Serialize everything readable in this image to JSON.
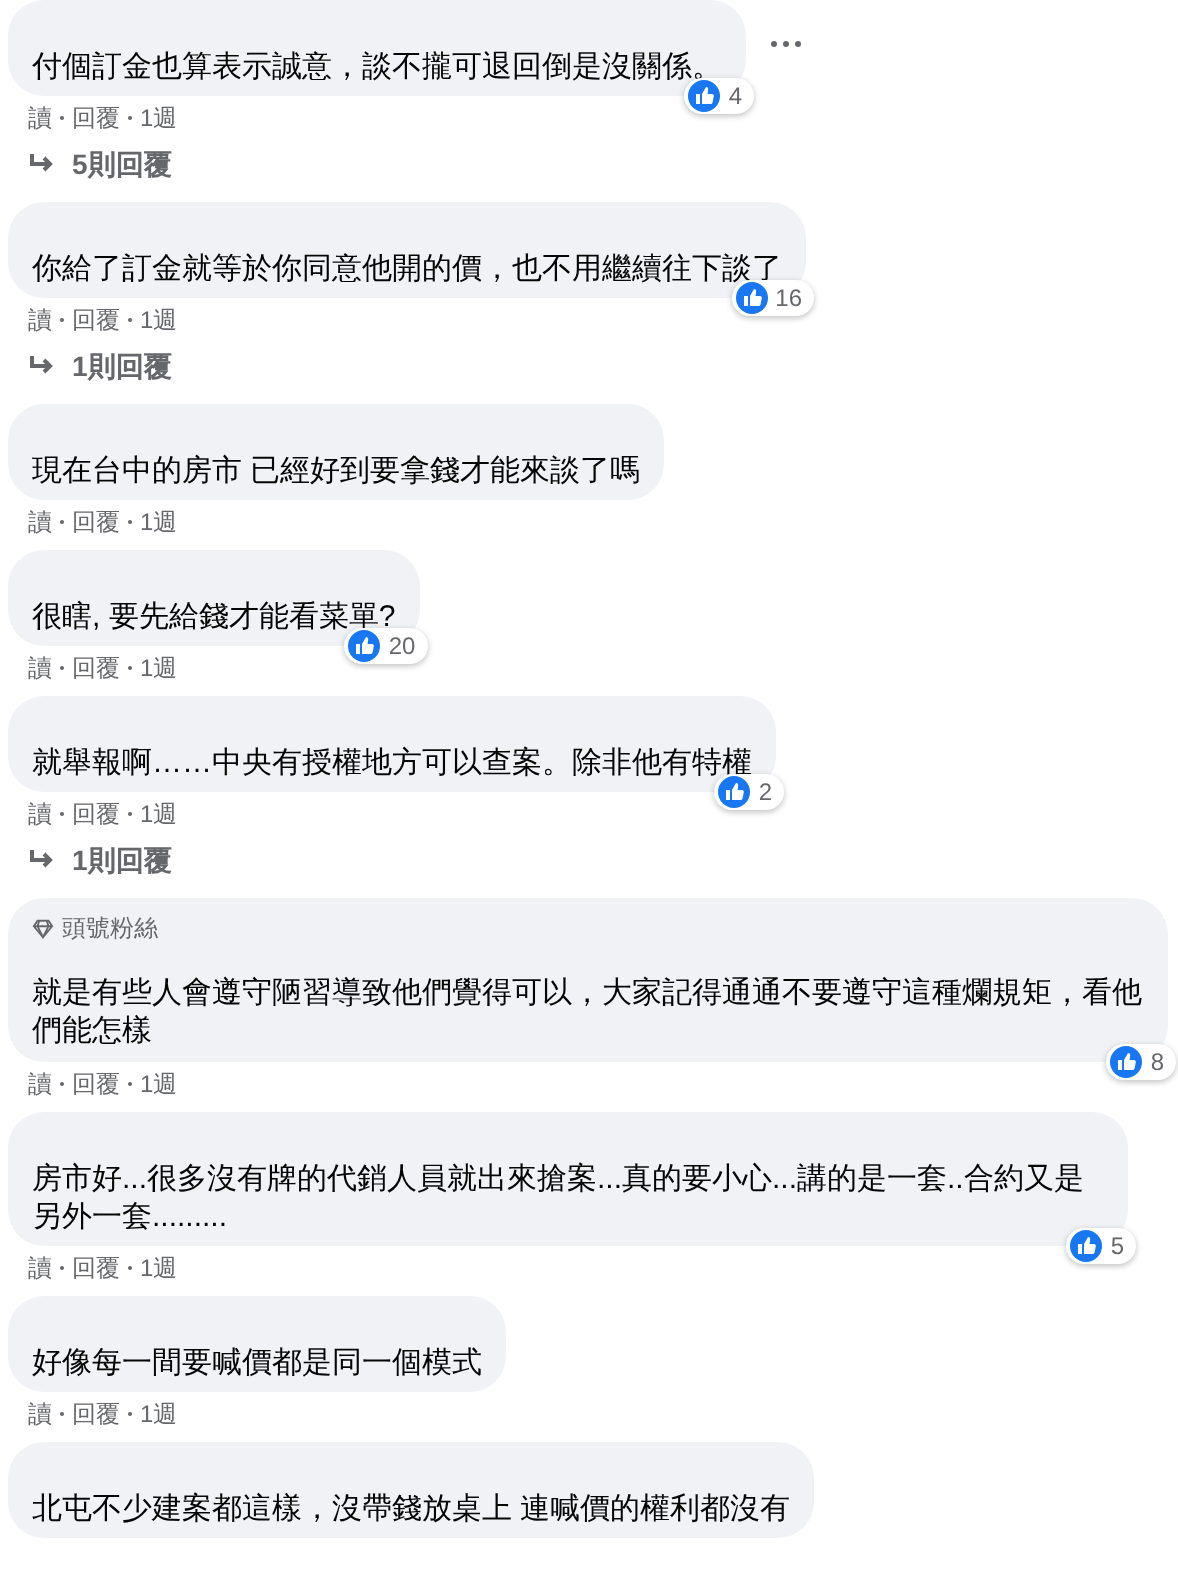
{
  "comments": [
    {
      "text": "付個訂金也算表示誠意，談不攏可退回倒是沒關係。",
      "actions": [
        "讀",
        "回覆",
        "1週"
      ],
      "likes": "4",
      "replies": "5則回覆",
      "menu_shown": true
    },
    {
      "text": "你給了訂金就等於你同意他開的價，也不用繼續往下談了",
      "actions": [
        "讀",
        "回覆",
        "1週"
      ],
      "likes": "16",
      "replies": "1則回覆",
      "menu_shown": false
    },
    {
      "text": "現在台中的房市 已經好到要拿錢才能來談了嗎",
      "actions": [
        "讀",
        "回覆",
        "1週"
      ],
      "menu_shown": false
    },
    {
      "text": "很瞎, 要先給錢才能看菜單?",
      "actions": [
        "讀",
        "回覆",
        "1週"
      ],
      "likes": "20",
      "menu_shown": false
    },
    {
      "text": "就舉報啊……中央有授權地方可以查案。除非他有特權",
      "actions": [
        "讀",
        "回覆",
        "1週"
      ],
      "likes": "2",
      "replies": "1則回覆",
      "menu_shown": false
    },
    {
      "badge": "頭號粉絲",
      "text": "就是有些人會遵守陋習導致他們覺得可以，大家記得通通不要遵守這種爛規矩，看他們能怎樣",
      "actions": [
        "讀",
        "回覆",
        "1週"
      ],
      "likes": "8",
      "menu_shown": false
    },
    {
      "text": "房市好...很多沒有牌的代銷人員就出來搶案...真的要小心...講的是一套..合約又是另外一套.........",
      "actions": [
        "讀",
        "回覆",
        "1週"
      ],
      "likes": "5",
      "menu_shown": false
    },
    {
      "text": "好像每一間要喊價都是同一個模式",
      "actions": [
        "讀",
        "回覆",
        "1週"
      ],
      "menu_shown": false
    },
    {
      "text": "北屯不少建案都這樣，沒帶錢放桌上 連喊價的權利都沒有",
      "menu_shown": false
    }
  ]
}
